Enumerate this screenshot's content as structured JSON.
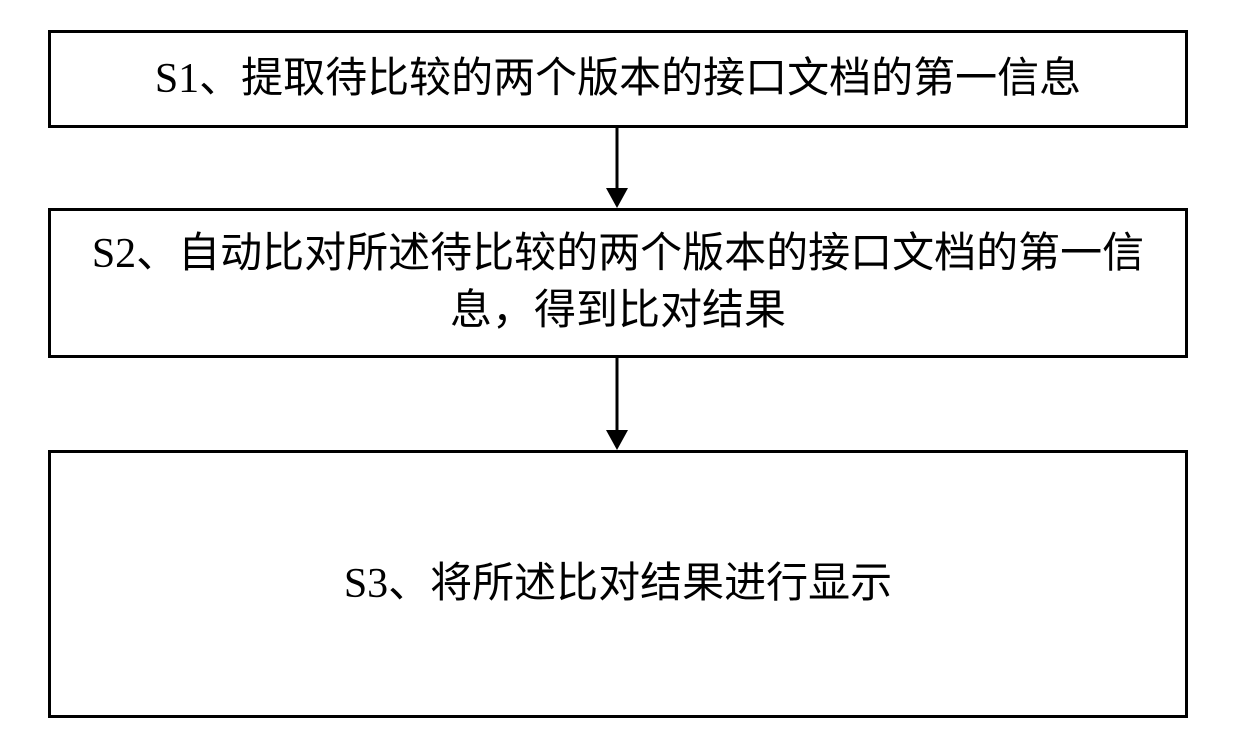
{
  "flowchart": {
    "steps": {
      "s1": "S1、提取待比较的两个版本的接口文档的第一信息",
      "s2": "S2、自动比对所述待比较的两个版本的接口文档的第一信息，得到比对结果",
      "s3": "S3、将所述比对结果进行显示"
    }
  }
}
